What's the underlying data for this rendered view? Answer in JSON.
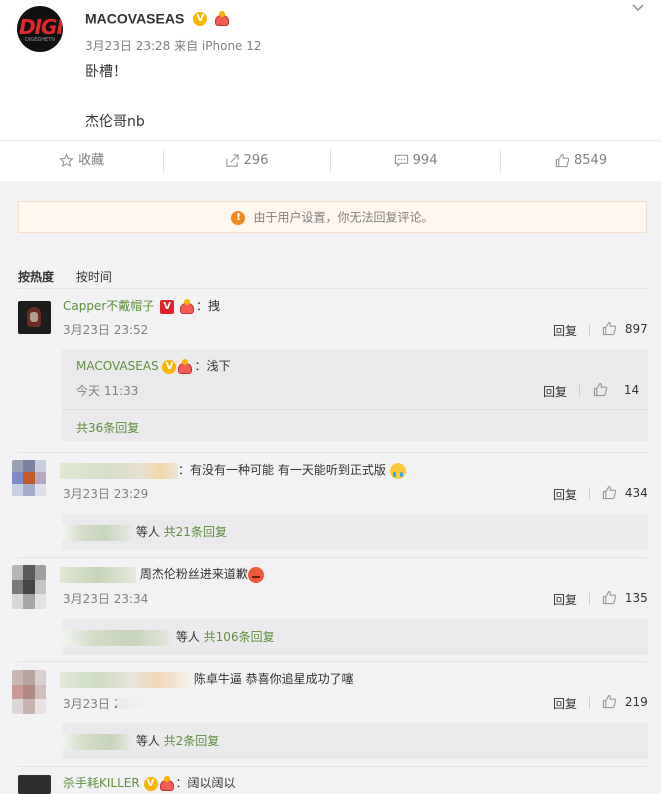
{
  "post": {
    "username": "MACOVASEAS",
    "meta": "3月23日 23:28 来自 iPhone 12",
    "lines": [
      "卧槽！",
      "杰伦哥nb"
    ],
    "avatar_text": "DIGI",
    "avatar_subtext": "DIGEGHETN"
  },
  "toolbar": {
    "favorite_label": "收藏",
    "forward_count": "296",
    "comment_count": "994",
    "like_count": "8549"
  },
  "notice": "由于用户设置，你无法回复评论。",
  "sort_tabs": {
    "hot": "按热度",
    "time": "按时间"
  },
  "reply_label": "回复",
  "comments": [
    {
      "user": "Capper不戴帽子",
      "text": "：拽",
      "time": "3月23日 23:52",
      "likes": "897",
      "sub": {
        "user": "MACOVASEAS",
        "text": "：浅下",
        "time": "今天 11:33",
        "likes": "14"
      },
      "more": "共36条回复"
    },
    {
      "text": "：有没有一种可能 有一天能听到正式版",
      "time": "3月23日 23:29",
      "likes": "434",
      "others": "等人",
      "more": "共21条回复"
    },
    {
      "text": "周杰伦粉丝进来道歉",
      "time": "3月23日 23:34",
      "likes": "135",
      "others": "等人",
      "more": "共106条回复"
    },
    {
      "text": "陈卓牛逼 恭喜你追星成功了噻",
      "time": "3月23日 23:",
      "likes": "219",
      "others": "等人",
      "more": "共2条回复"
    },
    {
      "user": "杀手耗KILLER",
      "text": "：阔以阔以"
    }
  ],
  "icons": {
    "collapse": "chevron-down-icon",
    "favorite": "star-icon",
    "forward": "share-icon",
    "comment": "comment-icon",
    "like": "thumb-up-icon",
    "notice": "warning-icon"
  },
  "colors": {
    "username_green": "#5e8f3b",
    "notice_orange": "#f08a24"
  }
}
